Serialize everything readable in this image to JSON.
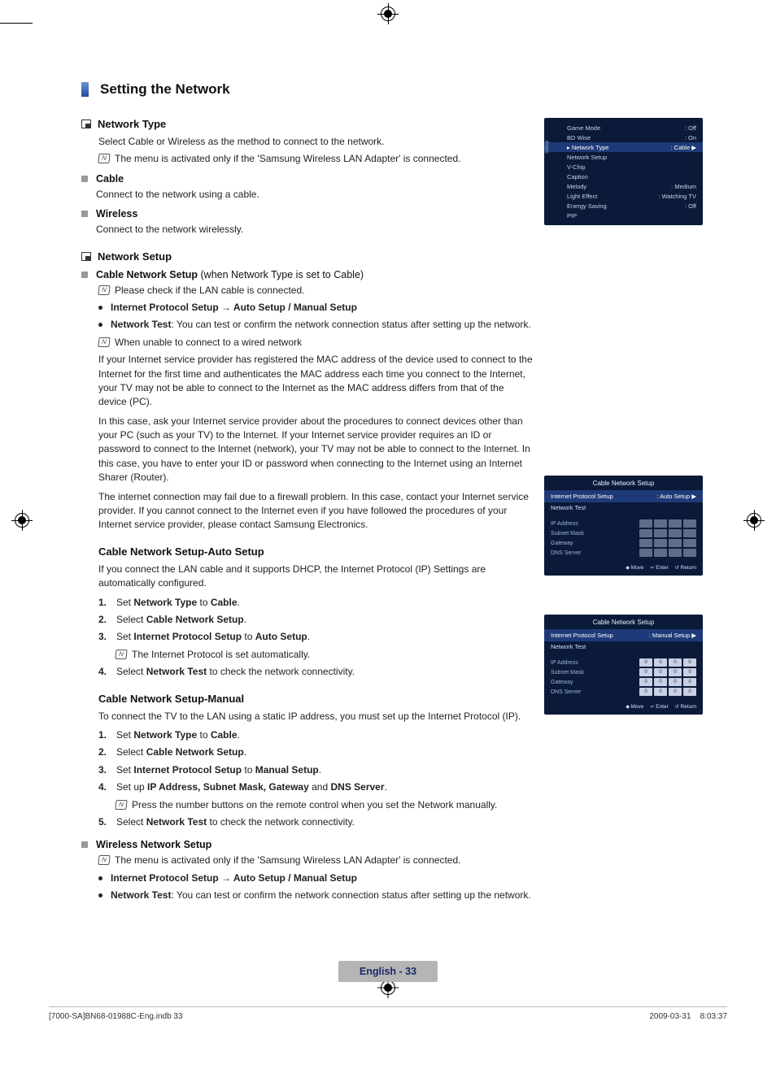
{
  "heading": "Setting the Network",
  "network_type": {
    "title": "Network Type",
    "desc": "Select Cable or Wireless as the method to connect to the network.",
    "note": "The menu is activated only if the 'Samsung Wireless LAN Adapter' is connected.",
    "cable_title": "Cable",
    "cable_desc": "Connect to the network using a cable.",
    "wireless_title": "Wireless",
    "wireless_desc": "Connect to the network wirelessly."
  },
  "network_setup": {
    "title": "Network Setup",
    "cable_title": "Cable Network Setup",
    "cable_cond": " (when Network Type is set to Cable)",
    "note1": "Please check if the LAN cable is connected.",
    "bullet1_a": "Internet Protocol Setup → Auto Setup / Manual Setup",
    "bullet2_a": "Network Test",
    "bullet2_b": ": You can test or confirm the network connection status after setting up the network.",
    "note2": "When unable to connect to a wired network",
    "para1": "If your Internet service provider has registered the MAC address of the device used to connect to the Internet for the first time and authenticates the MAC address each time you connect to the Internet, your TV may not be able to connect to the Internet as the MAC address differs from that of the device (PC).",
    "para2": "In this case, ask your Internet service provider about the procedures to connect devices other than your PC (such as your TV) to the Internet. If your Internet service provider requires an ID or password to connect to the Internet (network), your TV may not be able to connect to the Internet. In this case, you have to enter your ID or password when connecting to the Internet using an Internet Sharer (Router).",
    "para3": "The internet connection may fail due to a firewall problem. In this case, contact your Internet service provider. If you cannot connect to the Internet even if you have followed the procedures of your Internet service provider, please contact Samsung Electronics."
  },
  "auto_setup": {
    "title": "Cable Network Setup-Auto Setup",
    "desc": "If you connect the LAN cable and it supports DHCP, the Internet Protocol (IP) Settings are automatically configured.",
    "s1a": "Set ",
    "s1b": "Network Type",
    "s1c": " to ",
    "s1d": "Cable",
    "s1e": ".",
    "s2a": "Select ",
    "s2b": "Cable Network Setup",
    "s2c": ".",
    "s3a": "Set ",
    "s3b": "Internet Protocol Setup",
    "s3c": " to ",
    "s3d": "Auto Setup",
    "s3e": ".",
    "s3note": "The Internet Protocol is set automatically.",
    "s4a": "Select ",
    "s4b": "Network Test",
    "s4c": " to check the network connectivity."
  },
  "manual_setup": {
    "title": "Cable Network Setup-Manual",
    "desc": "To connect the TV to the LAN using a static IP address, you must set up the Internet Protocol (IP).",
    "s1a": "Set ",
    "s1b": "Network Type",
    "s1c": " to ",
    "s1d": "Cable",
    "s1e": ".",
    "s2a": "Select ",
    "s2b": "Cable Network Setup",
    "s2c": ".",
    "s3a": "Set ",
    "s3b": "Internet Protocol Setup",
    "s3c": " to ",
    "s3d": "Manual Setup",
    "s3e": ".",
    "s4a": "Set up ",
    "s4b": "IP Address, Subnet Mask, Gateway",
    "s4c": " and ",
    "s4d": "DNS Server",
    "s4e": ".",
    "s4note": "Press the number buttons on the remote control when you set the Network manually.",
    "s5a": "Select ",
    "s5b": "Network Test",
    "s5c": " to check the network connectivity."
  },
  "wireless_setup": {
    "title": "Wireless Network Setup",
    "note": "The menu is activated only if the 'Samsung Wireless LAN Adapter' is connected.",
    "bullet1": "Internet Protocol Setup → Auto Setup / Manual Setup",
    "bullet2_a": "Network Test",
    "bullet2_b": ": You can test or confirm the network connection status after setting up the network."
  },
  "osd1": {
    "side": "Setup",
    "rows": [
      {
        "l": "Game Mode",
        "r": ": Off"
      },
      {
        "l": "BD Wise",
        "r": ": On"
      },
      {
        "l": "Network Type",
        "r": ": Cable",
        "hl": true,
        "arrow": true
      },
      {
        "l": "Network Setup",
        "r": ""
      },
      {
        "l": "V-Chip",
        "r": ""
      },
      {
        "l": "Caption",
        "r": ""
      },
      {
        "l": "Melody",
        "r": ": Medium"
      },
      {
        "l": "Light Effect",
        "r": ": Watching TV"
      },
      {
        "l": "Energy Saving",
        "r": ": Off"
      },
      {
        "l": "PIP",
        "r": ""
      }
    ]
  },
  "osd2": {
    "title": "Cable Network Setup",
    "sel_l": "Internet Protocol Setup",
    "sel_r": ": Auto Setup",
    "test": "Network Test",
    "labels": [
      "IP Address",
      "Subnet Mask",
      "Gateway",
      "DNS Server"
    ],
    "footer": {
      "move": "Move",
      "enter": "Enter",
      "ret": "Return"
    }
  },
  "osd3": {
    "title": "Cable Network Setup",
    "sel_l": "Internet Protocol Setup",
    "sel_r": ": Manual Setup",
    "test": "Network Test",
    "labels": [
      "IP Address",
      "Subnet Mask",
      "Gateway",
      "DNS Server"
    ],
    "val": "0",
    "footer": {
      "move": "Move",
      "enter": "Enter",
      "ret": "Return"
    }
  },
  "page_foot": "English - 33",
  "footer": {
    "left": "[7000-SA]BN68-01988C-Eng.indb   33",
    "right": "2009-03-31      8:03:37"
  }
}
